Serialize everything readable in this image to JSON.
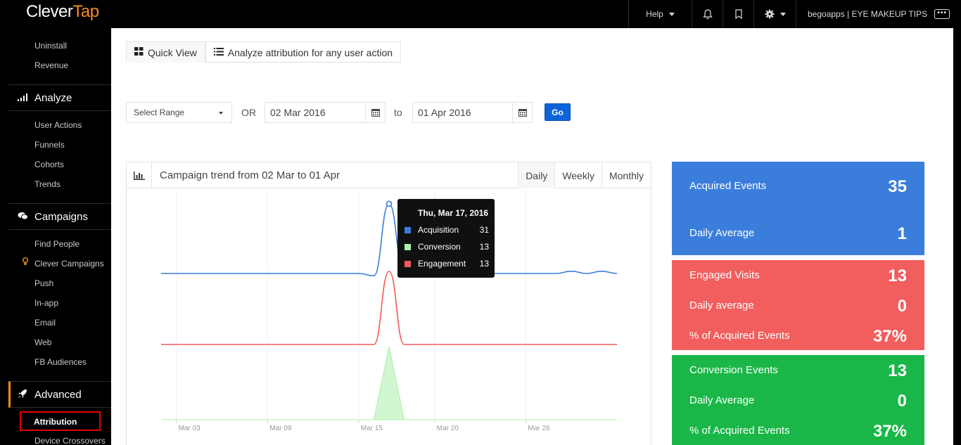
{
  "brand": {
    "part1": "Clever",
    "part2": "Tap"
  },
  "topnav": {
    "help": "Help",
    "account": "begoapps | EYE MAKEUP TIPS",
    "more": "•••"
  },
  "sidebar": {
    "items_top": [
      "Uninstall",
      "Revenue"
    ],
    "analyze": {
      "title": "Analyze",
      "items": [
        "User Actions",
        "Funnels",
        "Cohorts",
        "Trends"
      ]
    },
    "campaigns": {
      "title": "Campaigns",
      "items": [
        "Find People",
        "Clever Campaigns",
        "Push",
        "In-app",
        "Email",
        "Web",
        "FB Audiences"
      ]
    },
    "advanced": {
      "title": "Advanced",
      "items": [
        "Attribution",
        "Device Crossovers"
      ]
    }
  },
  "tabs": {
    "quick_view": "Quick View",
    "analyze_attr": "Analyze attribution for any user action"
  },
  "range": {
    "select": "Select Range",
    "or": "OR",
    "from": "02 Mar 2016",
    "to_label": "to",
    "to": "01 Apr 2016",
    "go": "Go"
  },
  "card": {
    "title": "Campaign trend from 02 Mar to 01 Apr",
    "periods": [
      "Daily",
      "Weekly",
      "Monthly"
    ]
  },
  "chart_data": {
    "type": "line",
    "title": "Campaign trend from 02 Mar to 01 Apr",
    "x_ticks": [
      "Mar 03",
      "Mar 09",
      "Mar 15",
      "Mar 20",
      "Mar 26"
    ],
    "x": [
      "Mar 02",
      "Mar 03",
      "Mar 04",
      "Mar 05",
      "Mar 06",
      "Mar 07",
      "Mar 08",
      "Mar 09",
      "Mar 10",
      "Mar 11",
      "Mar 12",
      "Mar 13",
      "Mar 14",
      "Mar 15",
      "Mar 16",
      "Mar 17",
      "Mar 18",
      "Mar 19",
      "Mar 20",
      "Mar 21",
      "Mar 22",
      "Mar 23",
      "Mar 24",
      "Mar 25",
      "Mar 26",
      "Mar 27",
      "Mar 28",
      "Mar 29",
      "Mar 30",
      "Mar 31",
      "Apr 01"
    ],
    "series": [
      {
        "name": "Acquisition",
        "color": "#3a7ddb",
        "values": [
          0,
          0,
          0,
          0,
          0,
          0,
          0,
          0,
          0,
          0,
          0,
          0,
          0,
          0,
          -1,
          31,
          0,
          0,
          0,
          0,
          0,
          0,
          0,
          0,
          0,
          0,
          0,
          1,
          0,
          1,
          0
        ]
      },
      {
        "name": "Engagement",
        "color": "#f15a5a",
        "values": [
          0,
          0,
          0,
          0,
          0,
          0,
          0,
          0,
          0,
          0,
          0,
          0,
          0,
          0,
          0,
          13,
          0,
          0,
          0,
          0,
          0,
          0,
          0,
          0,
          0,
          0,
          0,
          0,
          0,
          0,
          0
        ]
      },
      {
        "name": "Conversion",
        "color": "#aaf0a8",
        "values": [
          0,
          0,
          0,
          0,
          0,
          0,
          0,
          0,
          0,
          0,
          0,
          0,
          0,
          0,
          0,
          13,
          0,
          0,
          0,
          0,
          0,
          0,
          0,
          0,
          0,
          0,
          0,
          0,
          0,
          0,
          0
        ]
      }
    ],
    "tooltip": {
      "date": "Thu, Mar 17, 2016",
      "rows": [
        {
          "name": "Acquisition",
          "value": 31,
          "color": "#3a7ddb"
        },
        {
          "name": "Conversion",
          "value": 13,
          "color": "#aaf0a8"
        },
        {
          "name": "Engagement",
          "value": 13,
          "color": "#f15a5a"
        }
      ]
    }
  },
  "stats": {
    "acquired": {
      "label": "Acquired Events",
      "value": "35",
      "avg_label": "Daily Average",
      "avg": "1",
      "color": "#3a7ddb"
    },
    "engaged": {
      "label": "Engaged Visits",
      "value": "13",
      "avg_label": "Daily average",
      "avg": "0",
      "pct_label": "% of Acquired Events",
      "pct": "37%",
      "color": "#f25d5d"
    },
    "conversion": {
      "label": "Conversion Events",
      "value": "13",
      "avg_label": "Daily Average",
      "avg": "0",
      "pct_label": "% of Acquired Events",
      "pct": "37%",
      "color": "#1ab748"
    }
  }
}
